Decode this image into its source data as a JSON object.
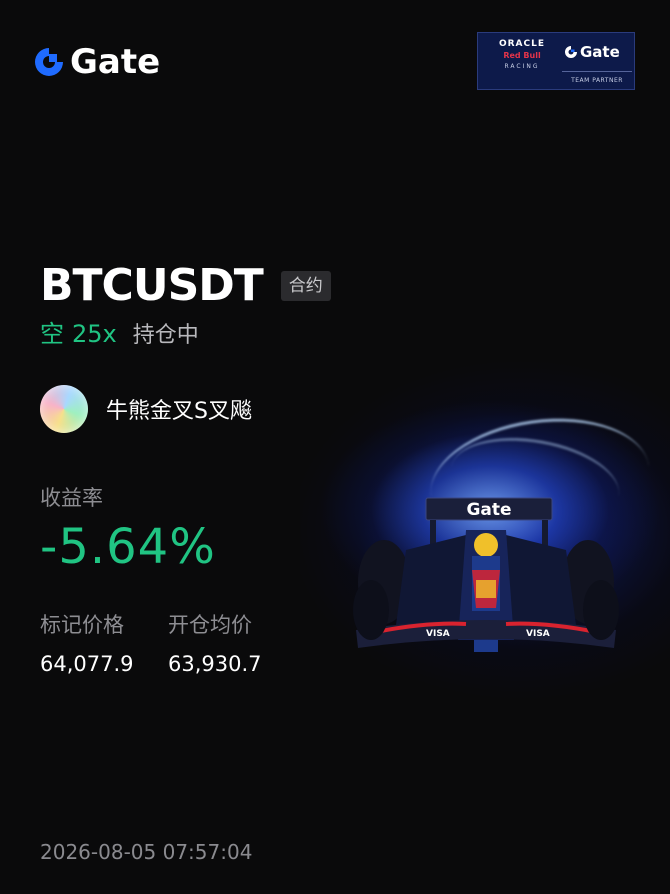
{
  "brand": {
    "name": "Gate",
    "color": "#1f6bff"
  },
  "partner_badge": {
    "line1": "ORACLE",
    "line2": "Red Bull",
    "line3": "RACING",
    "brand": "Gate",
    "caption": "TEAM PARTNER"
  },
  "position": {
    "symbol": "BTCUSDT",
    "type_tag": "合约",
    "side": "空",
    "leverage": "25x",
    "status": "持仓中"
  },
  "user": {
    "name": "牛熊金叉S叉飚"
  },
  "roi": {
    "label": "收益率",
    "value": "-5.64%"
  },
  "prices": {
    "mark_label": "标记价格",
    "mark_value": "64,077.9",
    "entry_label": "开仓均价",
    "entry_value": "63,930.7"
  },
  "timestamp": "2026-08-05 07:57:04",
  "colors": {
    "profit_green": "#20c483",
    "background": "#0a0a0b"
  },
  "car_livery": {
    "wing_text": "Gate",
    "sponsor": "VISA"
  }
}
